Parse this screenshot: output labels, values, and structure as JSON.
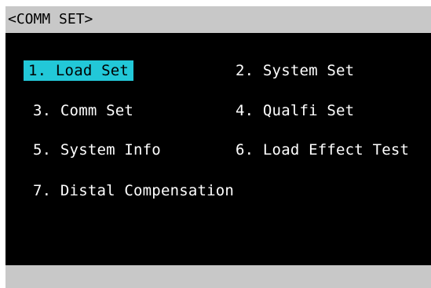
{
  "title": "<COMM SET>",
  "menu": {
    "items": [
      {
        "label": "1. Load Set",
        "selected": true
      },
      {
        "label": "2. System Set",
        "selected": false
      },
      {
        "label": "3. Comm Set",
        "selected": false
      },
      {
        "label": "4. Qualfi Set",
        "selected": false
      },
      {
        "label": "5. System Info",
        "selected": false
      },
      {
        "label": "6. Load Effect Test",
        "selected": false
      },
      {
        "label": "7. Distal Compensation",
        "selected": false
      }
    ]
  },
  "colors": {
    "screen_background": "#000000",
    "bar_background": "#c8c8c8",
    "selection_highlight": "#22c8d8",
    "text": "#ffffff",
    "selected_text": "#000000"
  }
}
